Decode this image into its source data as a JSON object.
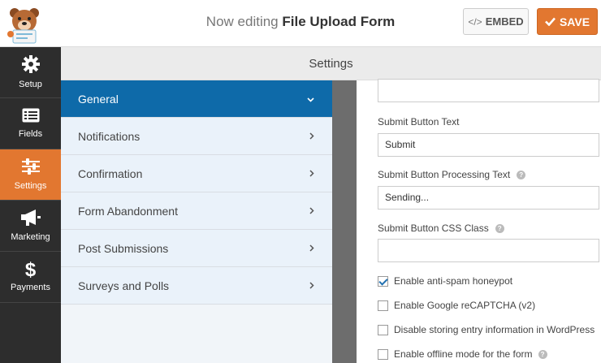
{
  "header": {
    "title_prefix": "Now editing",
    "form_name": "File Upload Form",
    "embed_label": "EMBED",
    "embed_icon_text": "</>",
    "save_label": "SAVE"
  },
  "leftnav": [
    {
      "label": "Setup",
      "icon": "gear-icon"
    },
    {
      "label": "Fields",
      "icon": "list-icon"
    },
    {
      "label": "Settings",
      "icon": "sliders-icon",
      "active": true
    },
    {
      "label": "Marketing",
      "icon": "megaphone-icon"
    },
    {
      "label": "Payments",
      "icon": "dollar-icon"
    }
  ],
  "settings_title": "Settings",
  "sections": [
    {
      "label": "General",
      "active": true
    },
    {
      "label": "Notifications"
    },
    {
      "label": "Confirmation"
    },
    {
      "label": "Form Abandonment"
    },
    {
      "label": "Post Submissions"
    },
    {
      "label": "Surveys and Polls"
    }
  ],
  "form": {
    "top_field_value": "",
    "submit_text_label": "Submit Button Text",
    "submit_text_value": "Submit",
    "processing_label": "Submit Button Processing Text",
    "processing_value": "Sending...",
    "css_class_label": "Submit Button CSS Class",
    "css_class_value": "",
    "checkboxes": [
      {
        "label": "Enable anti-spam honeypot",
        "checked": true
      },
      {
        "label": "Enable Google reCAPTCHA (v2)",
        "checked": false
      },
      {
        "label": "Disable storing entry information in WordPress",
        "checked": false
      },
      {
        "label": "Enable offline mode for the form",
        "checked": false
      }
    ]
  },
  "colors": {
    "accent": "#e27730",
    "active_section": "#0e6aa9",
    "nav_bg": "#2d2d2d"
  }
}
